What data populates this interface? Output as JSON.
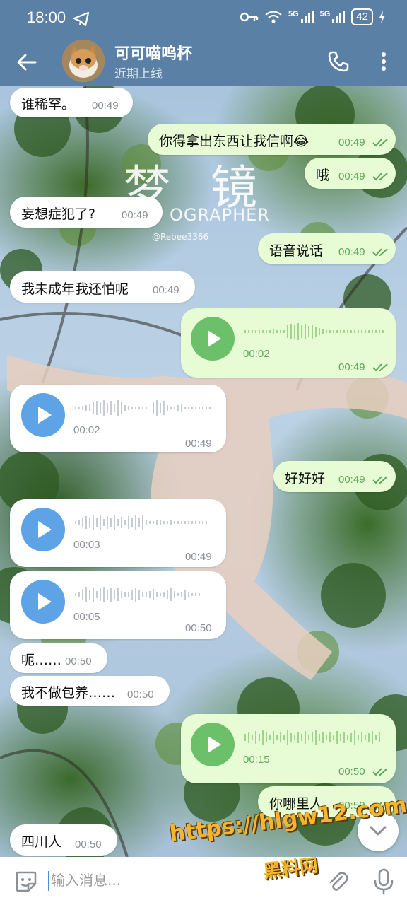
{
  "status_bar": {
    "time": "18:00",
    "network_1": "5G",
    "network_2": "5G",
    "battery": "42"
  },
  "header": {
    "contact_name": "可可喵呜杯",
    "contact_status": "近期上线"
  },
  "background": {
    "title": "梦 镜",
    "subtitle": "OGRAPHER",
    "handle": "@Rebee3366"
  },
  "messages": [
    {
      "dir": "in",
      "text": "谁稀罕。",
      "time": "00:49"
    },
    {
      "dir": "out",
      "text": "你得拿出东西让我信啊😂",
      "time": "00:49"
    },
    {
      "dir": "out",
      "text": "哦",
      "time": "00:49"
    },
    {
      "dir": "in",
      "text": "妄想症犯了?",
      "time": "00:49"
    },
    {
      "dir": "out",
      "text": "语音说话",
      "time": "00:49"
    },
    {
      "dir": "in",
      "text": "我未成年我还怕呢",
      "time": "00:49"
    },
    {
      "dir": "out",
      "voice": true,
      "duration": "00:02",
      "time": "00:49"
    },
    {
      "dir": "in",
      "voice": true,
      "duration": "00:02",
      "time": "00:49"
    },
    {
      "dir": "out",
      "text": "好好好",
      "time": "00:49"
    },
    {
      "dir": "in",
      "voice": true,
      "duration": "00:03",
      "time": "00:49"
    },
    {
      "dir": "in",
      "voice": true,
      "duration": "00:05",
      "time": "00:50"
    },
    {
      "dir": "in",
      "text": "呃……",
      "time": "00:50"
    },
    {
      "dir": "in",
      "text": "我不做包养……",
      "time": "00:50"
    },
    {
      "dir": "out",
      "voice": true,
      "duration": "00:15",
      "time": "00:50"
    },
    {
      "dir": "out",
      "text": "你哪里人",
      "time": "00:50"
    },
    {
      "dir": "in",
      "text": "四川人",
      "time": "00:50"
    }
  ],
  "input": {
    "placeholder": "输入消息..."
  },
  "watermark": {
    "url": "https://hlgw12.com",
    "name": "黑料网"
  },
  "colors": {
    "header": "#5b80a6",
    "incoming_bubble": "#ffffff",
    "outgoing_bubble": "#e7fbd5",
    "incoming_play": "#5ea3e6",
    "outgoing_play": "#6cc06a"
  }
}
